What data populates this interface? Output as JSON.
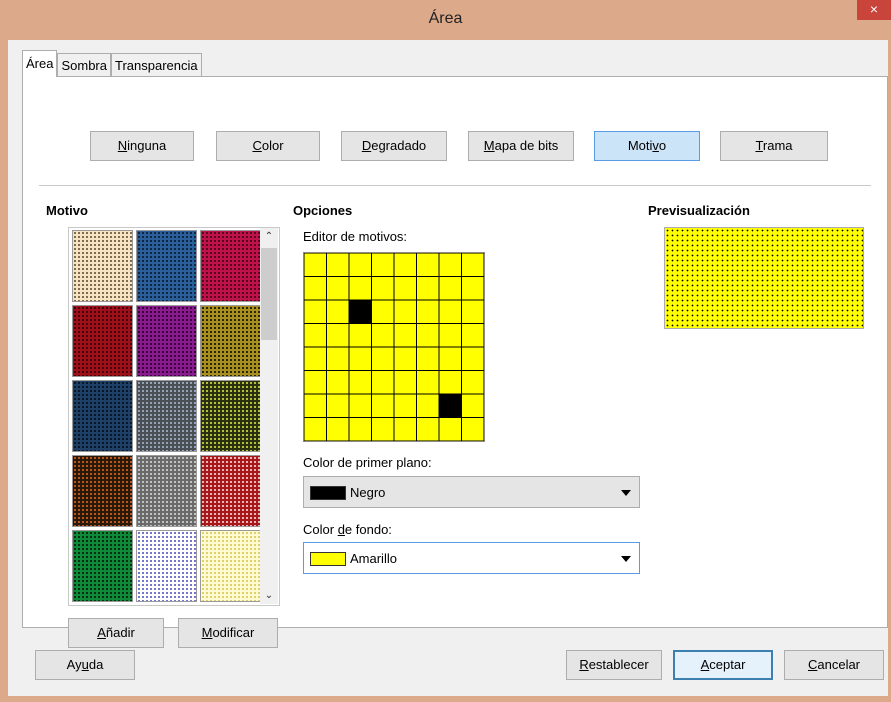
{
  "window": {
    "title": "Área",
    "close_glyph": "×"
  },
  "tabs": [
    {
      "label": "Área",
      "active": true
    },
    {
      "label": "Sombra",
      "active": false
    },
    {
      "label": "Transparencia",
      "active": false
    }
  ],
  "fill_types": [
    {
      "label": "Ninguna",
      "mnemonic_index": 0,
      "selected": false
    },
    {
      "label": "Color",
      "mnemonic_index": 0,
      "selected": false
    },
    {
      "label": "Degradado",
      "mnemonic_index": 0,
      "selected": false
    },
    {
      "label": "Mapa de bits",
      "mnemonic_index": 0,
      "selected": false
    },
    {
      "label": "Motivo",
      "mnemonic_index": 4,
      "selected": true
    },
    {
      "label": "Trama",
      "mnemonic_index": 0,
      "selected": false
    }
  ],
  "motivo": {
    "header": "Motivo",
    "swatches": [
      {
        "bg": "#f5e3c2",
        "fg": "#6b5a40"
      },
      {
        "bg": "#2a5f9a",
        "fg": "#0a1e3a"
      },
      {
        "bg": "#c0124a",
        "fg": "#4a0018"
      },
      {
        "bg": "#a0101a",
        "fg": "#3a0008"
      },
      {
        "bg": "#8a1a8e",
        "fg": "#2a0030"
      },
      {
        "bg": "#a89020",
        "fg": "#1a1400"
      },
      {
        "bg": "#1e3f66",
        "fg": "#06101e"
      },
      {
        "bg": "#4a4e55",
        "fg": "#a0b0c0"
      },
      {
        "bg": "#2a3010",
        "fg": "#c8d840"
      },
      {
        "bg": "#2a1808",
        "fg": "#d06020"
      },
      {
        "bg": "#6a6a6a",
        "fg": "#d0d0d0"
      },
      {
        "bg": "#a8181a",
        "fg": "#f0d0d0"
      },
      {
        "bg": "#0e8a38",
        "fg": "#00200c"
      },
      {
        "bg": "#ffffff",
        "fg": "#6060c0"
      },
      {
        "bg": "#fffbd0",
        "fg": "#d8c860"
      }
    ],
    "add_button": {
      "label": "Añadir",
      "mnemonic_index": 0
    },
    "modify_button": {
      "label": "Modificar",
      "mnemonic_index": 0
    }
  },
  "opciones": {
    "header": "Opciones",
    "editor_label": "Editor de motivos:",
    "editor_grid": {
      "size": 8,
      "bg_color": "#ffff00",
      "fg_color": "#000000",
      "filled_cells": [
        [
          2,
          2
        ],
        [
          6,
          6
        ]
      ]
    },
    "foreground": {
      "label": "Color de primer plano:",
      "value": "Negro",
      "swatch": "#000000"
    },
    "background": {
      "label_pre": "Color ",
      "label_mn": "d",
      "label_post": "e fondo:",
      "value": "Amarillo",
      "swatch": "#ffff00"
    }
  },
  "preview": {
    "header": "Previsualización"
  },
  "footer": {
    "help": {
      "label": "Ayuda",
      "mnemonic_index": 2
    },
    "reset": {
      "label": "Restablecer",
      "mnemonic_index": 0
    },
    "ok": {
      "label": "Aceptar",
      "mnemonic_index": 0
    },
    "cancel": {
      "label": "Cancelar",
      "mnemonic_index": 0
    }
  }
}
